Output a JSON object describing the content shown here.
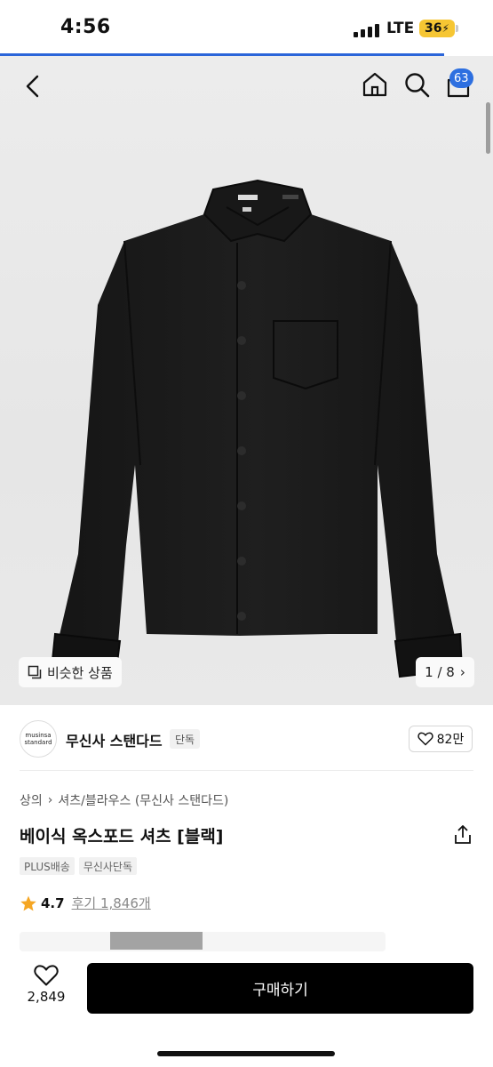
{
  "status_bar": {
    "time": "4:56",
    "network": "LTE",
    "battery": "36"
  },
  "page_progress": 0.9,
  "nav": {
    "cart_count": "63"
  },
  "gallery": {
    "similar_label": "비슷한 상품",
    "pager": "1 / 8",
    "image_subject": "black button-down oxford shirt"
  },
  "brand": {
    "logo_line1": "musinsa",
    "logo_line2": "standard",
    "name": "무신사 스탠다드",
    "tag": "단독",
    "likes": "82만"
  },
  "product": {
    "breadcrumb": [
      "상의",
      "셔츠/블라우스 (무신사 스탠다드)"
    ],
    "title": "베이식 옥스포드 셔츠 [블랙]",
    "tags": [
      "PLUS배송",
      "무신사단독"
    ],
    "rating": "4.7",
    "reviews": "후기 1,846개"
  },
  "bottom_bar": {
    "wish_count": "2,849",
    "buy_label": "구매하기"
  },
  "colors": {
    "accent": "#2d6fe0",
    "star": "#f5a623",
    "buy_button": "#000000"
  }
}
